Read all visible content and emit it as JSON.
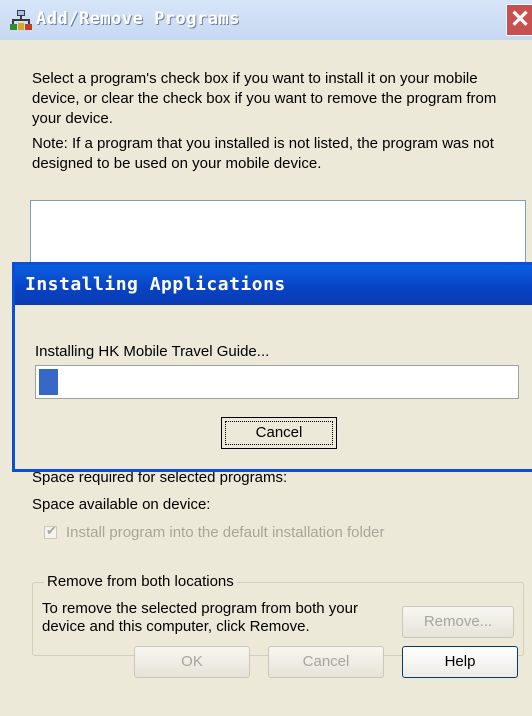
{
  "window": {
    "title": "Add/Remove Programs",
    "intro": "Select a program's check box if you want to install it on your mobile device, or clear the check box if you want to remove the program from your device.",
    "note": "Note:  If a program that you installed is not listed, the program was not designed to be used on your mobile device.",
    "space_required": "Space required for selected programs:",
    "space_available": "Space available on device:",
    "install_default_label": "Install program into the default installation folder",
    "install_default_checked": true,
    "group_title": "Remove from both locations",
    "group_text": "To remove the selected program from both your device and this computer, click Remove.",
    "remove_button": "Remove...",
    "ok_button": "OK",
    "cancel_button": "Cancel",
    "help_button": "Help"
  },
  "progress_dialog": {
    "title": "Installing Applications",
    "message": "Installing HK Mobile Travel Guide...",
    "progress_fraction": 0.04,
    "cancel_button": "Cancel"
  }
}
